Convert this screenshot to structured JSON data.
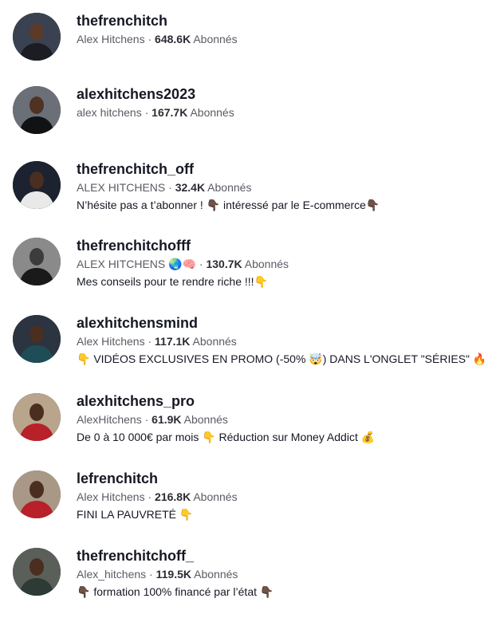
{
  "accounts": [
    {
      "username": "thefrenchitch",
      "display_name": "Alex Hitchens",
      "separator": " · ",
      "followers": "648.6K",
      "followers_label": " Abonnés",
      "bio": "",
      "avatar_icon": "profile-photo-dark-suit",
      "avatar_colors": {
        "bg": "#3a4150",
        "figure": "#1b1d22",
        "skin": "#5a3b2a"
      }
    },
    {
      "username": "alexhitchens2023",
      "display_name": "alex hitchens",
      "separator": " · ",
      "followers": "167.7K",
      "followers_label": " Abonnés",
      "bio": "",
      "avatar_icon": "profile-photo-black-shirt",
      "avatar_colors": {
        "bg": "#6b6f78",
        "figure": "#111214",
        "skin": "#4e3222"
      }
    },
    {
      "username": "thefrenchitch_off",
      "display_name": "ALEX HITCHENS",
      "separator": " · ",
      "followers": "32.4K",
      "followers_label": " Abonnés",
      "bio": "N’hésite pas a t’abonner ! 👇🏿 intéressé par le E-commerce👇🏿",
      "avatar_icon": "profile-photo-white-turtleneck",
      "avatar_colors": {
        "bg": "#1c2230",
        "figure": "#e9e9ea",
        "skin": "#4a2e1f"
      }
    },
    {
      "username": "thefrenchitchofff",
      "display_name": "ALEX  HITCHENS  🌏🧠",
      "separator": " · ",
      "followers": "130.7K",
      "followers_label": " Abonnés",
      "bio": "Mes conseils pour te rendre riche !!!👇",
      "avatar_icon": "profile-photo-black-and-white",
      "avatar_colors": {
        "bg": "#8a8a8a",
        "figure": "#1a1a1a",
        "skin": "#3c3c3c"
      }
    },
    {
      "username": "alexhitchensmind",
      "display_name": "Alex Hitchens",
      "separator": " · ",
      "followers": "117.1K",
      "followers_label": " Abonnés",
      "bio": "👇 VIDÉOS EXCLUSIVES EN PROMO (-50% 🤯) DANS L'ONGLET \"SÉRIES\" 🔥",
      "avatar_icon": "profile-photo-teal-sweater",
      "avatar_colors": {
        "bg": "#2b3440",
        "figure": "#1f4d57",
        "skin": "#4a2e1f"
      }
    },
    {
      "username": "alexhitchens_pro",
      "display_name": "AlexHitchens",
      "separator": " · ",
      "followers": "61.9K",
      "followers_label": " Abonnés",
      "bio": "De 0 à 10 000€ par mois 👇 Réduction sur Money Addict 💰",
      "avatar_icon": "profile-photo-red-sweater-street",
      "avatar_colors": {
        "bg": "#b9a48c",
        "figure": "#b8202a",
        "skin": "#4a2e1f"
      }
    },
    {
      "username": "lefrenchitch",
      "display_name": "Alex Hitchens",
      "separator": " · ",
      "followers": "216.8K",
      "followers_label": " Abonnés",
      "bio": "FINI LA PAUVRETÉ 👇",
      "avatar_icon": "profile-photo-red-sweater-street",
      "avatar_colors": {
        "bg": "#a99886",
        "figure": "#b8202a",
        "skin": "#4a2e1f"
      }
    },
    {
      "username": "thefrenchitchoff_",
      "display_name": "Alex_hitchens",
      "separator": " · ",
      "followers": "119.5K",
      "followers_label": " Abonnés",
      "bio": "👇🏿 formation 100% financé par l’état 👇🏿",
      "avatar_icon": "profile-photo-two-people",
      "avatar_colors": {
        "bg": "#5b5f5a",
        "figure": "#2d3a35",
        "skin": "#4a2e1f"
      }
    }
  ]
}
